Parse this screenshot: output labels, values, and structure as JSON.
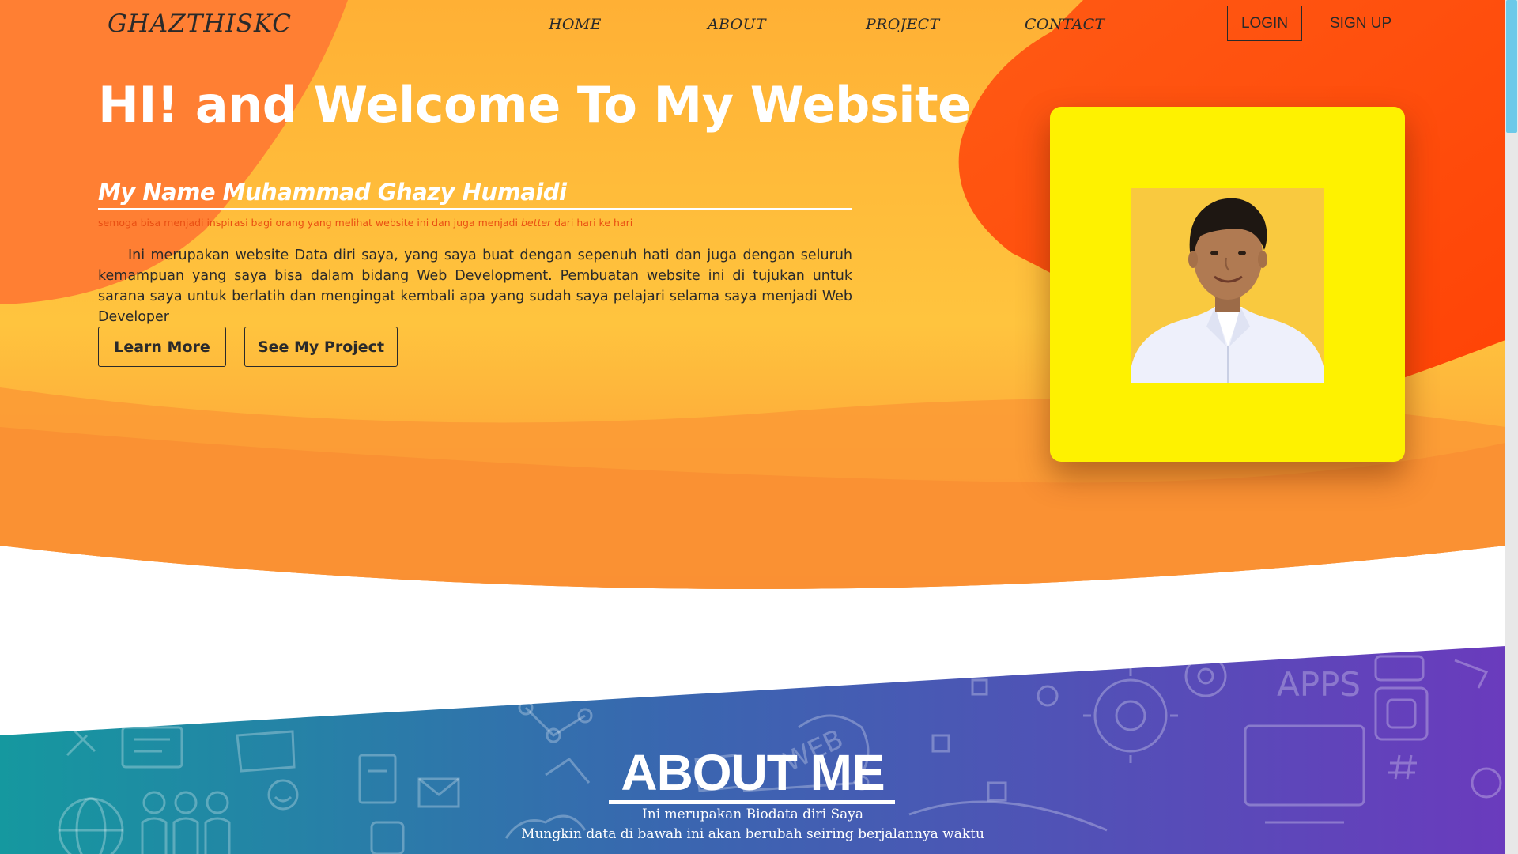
{
  "nav": {
    "brand": "GHAZTHISKC",
    "links": [
      "HOME",
      "ABOUT",
      "PROJECT",
      "CONTACT"
    ],
    "login": "LOGIN",
    "signup": "SIGN UP"
  },
  "hero": {
    "title": "HI! and Welcome To My Website",
    "name": "My Name Muhammad Ghazy Humaidi",
    "subtitle_before": "semoga bisa menjadi inspirasi bagi orang yang melihat website ini dan juga menjadi ",
    "subtitle_emph": "better",
    "subtitle_after": " dari hari ke hari",
    "paragraph": "Ini merupakan website Data diri saya, yang saya buat dengan sepenuh hati dan juga dengan seluruh kemampuan yang saya bisa dalam bidang Web Development. Pembuatan website ini di tujukan untuk sarana saya untuk berlatih dan mengingat kembali apa yang sudah saya pelajari selama saya menjadi Web Developer",
    "learn_more": "Learn More",
    "see_project": "See My Project"
  },
  "about": {
    "title": "ABOUT ME",
    "line1": "Ini merupakan Biodata diri Saya",
    "line2": "Mungkin data di bawah ini akan berubah seiring berjalannya waktu",
    "doodle_words": [
      "APPS",
      "WEB"
    ]
  },
  "colors": {
    "hero_orange": "#ffb236",
    "accent_red": "#ff4a0a",
    "card_yellow": "#fef200",
    "about_teal": "#1b8fa8",
    "about_purple": "#6a3db8"
  }
}
